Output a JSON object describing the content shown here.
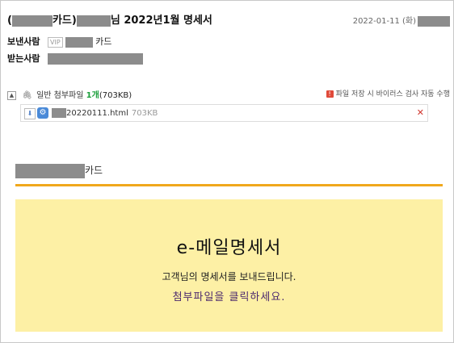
{
  "subject": {
    "open_paren": "(",
    "card_suffix": "카드)",
    "title_suffix": "님 2022년1월 명세서"
  },
  "date": "2022-01-11 (화)",
  "sender": {
    "label": "보낸사람",
    "vip_badge": "VIP",
    "name_suffix": "카드"
  },
  "receiver": {
    "label": "받는사람"
  },
  "attachments": {
    "toggle": "▲",
    "label": "일반 첨부파일",
    "count": "1개",
    "total_size": "(703KB)",
    "warning": "파일 저장 시 바이러스 검사 자동 수행",
    "files": [
      {
        "name_suffix": "20220111.html",
        "size": "703KB"
      }
    ]
  },
  "brand": {
    "suffix": "카드"
  },
  "banner": {
    "title": "e-메일명세서",
    "line1": "고객님의 명세서를 보내드립니다.",
    "line2": "첨부파일을 클릭하세요."
  },
  "colors": {
    "accent_rule": "#f0a81c",
    "banner_bg": "#fdf0a5",
    "count_green": "#1a9e3a",
    "delete_red": "#d0342c"
  },
  "icons": [
    "paperclip-icon",
    "warning-icon",
    "download-icon",
    "gear-icon",
    "close-icon",
    "collapse-icon"
  ]
}
